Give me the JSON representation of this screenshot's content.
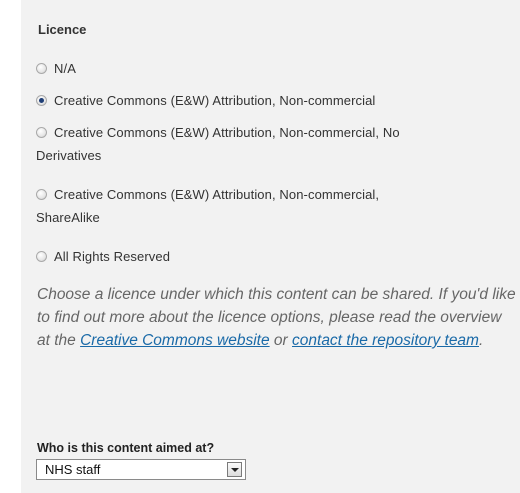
{
  "licence": {
    "label": "Licence",
    "options": [
      {
        "label": "N/A",
        "selected": false
      },
      {
        "label": "Creative Commons (E&W) Attribution, Non-commercial",
        "selected": true
      },
      {
        "label": "Creative Commons (E&W) Attribution, Non-commercial, No",
        "label_cont": "Derivatives",
        "selected": false
      },
      {
        "label": "Creative Commons (E&W) Attribution, Non-commercial,",
        "label_cont": "ShareAlike",
        "selected": false
      },
      {
        "label": "All Rights Reserved",
        "selected": false
      }
    ],
    "help": {
      "text_1": "Choose a licence under which this content can be shared. If you'd like to find out more about the licence options, please read the overview at the ",
      "link_1": "Creative Commons website",
      "text_2": " or ",
      "link_2": "contact the repository team",
      "text_3": "."
    }
  },
  "audience": {
    "label": "Who is this content aimed at?",
    "selected_value": "NHS staff"
  }
}
